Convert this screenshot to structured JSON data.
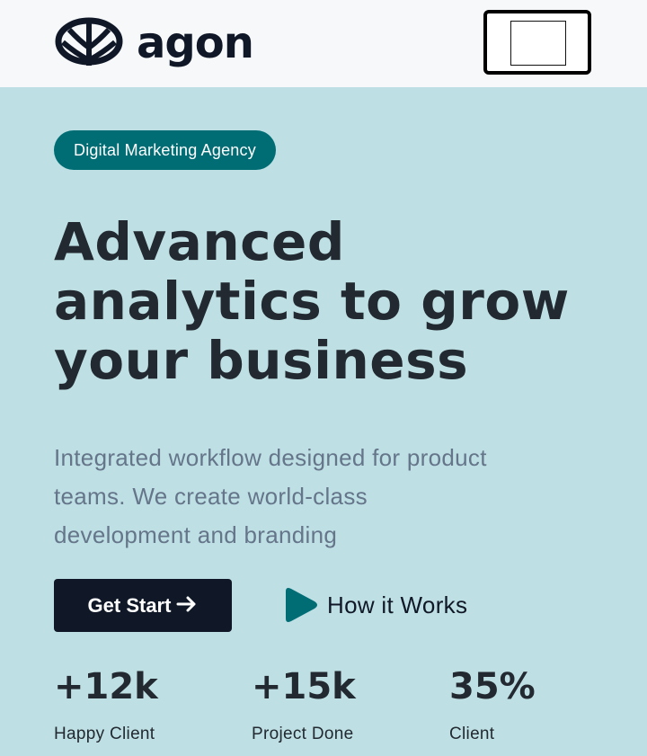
{
  "header": {
    "logo_text": "agon",
    "logo_icon": "leaf-icon",
    "menu_icon": "menu-icon"
  },
  "hero": {
    "badge": "Digital Marketing Agency",
    "headline_line1": "Advanced",
    "headline_line2": "analytics to grow",
    "headline_line3": "your business",
    "subtext_line1": "Integrated workflow designed for product",
    "subtext_line2": "teams. We create world-class",
    "subtext_line3": "development and branding",
    "primary_button": "Get Start",
    "primary_button_icon": "arrow-right-icon",
    "secondary_link": "How it Works",
    "secondary_icon": "play-icon"
  },
  "stats": [
    {
      "value": "+12k",
      "label": "Happy Client"
    },
    {
      "value": "+15k",
      "label": "Project Done"
    },
    {
      "value": "35%",
      "label": "Client"
    }
  ],
  "colors": {
    "header_bg": "#f6f8fa",
    "hero_bg": "#bee0e4",
    "accent": "#006d75",
    "dark": "#101828",
    "muted_text": "#65758a"
  }
}
